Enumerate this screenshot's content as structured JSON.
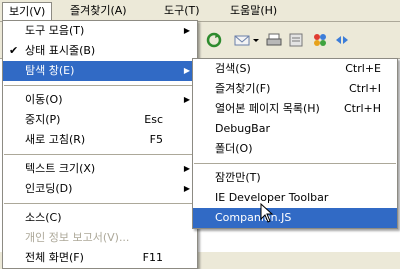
{
  "menubar": {
    "items": [
      {
        "label": "보기(V)"
      },
      {
        "label": "즐겨찾기(A)"
      },
      {
        "label": "도구(T)"
      },
      {
        "label": "도움말(H)"
      }
    ]
  },
  "toolbar": {
    "icons": [
      "refresh-icon",
      "mail-icon",
      "print-icon",
      "edit-icon",
      "messenger-icon",
      "media-icon"
    ]
  },
  "view_menu": {
    "items": [
      {
        "label": "도구 모음(T)",
        "arrow": true
      },
      {
        "label": "상태 표시줄(B)",
        "check": "✔"
      },
      {
        "label": "탐색 창(E)",
        "arrow": true,
        "highlighted": true
      },
      {
        "label": "이동(O)",
        "arrow": true
      },
      {
        "label": "중지(P)",
        "shortcut": "Esc"
      },
      {
        "label": "새로 고침(R)",
        "shortcut": "F5"
      },
      {
        "label": "텍스트 크기(X)",
        "arrow": true
      },
      {
        "label": "인코딩(D)",
        "arrow": true
      },
      {
        "label": "소스(C)"
      },
      {
        "label": "개인 정보 보고서(V)...",
        "disabled": true
      },
      {
        "label": "전체 화면(F)",
        "shortcut": "F11"
      }
    ]
  },
  "explorer_submenu": {
    "items": [
      {
        "label": "검색(S)",
        "shortcut": "Ctrl+E"
      },
      {
        "label": "즐겨찾기(F)",
        "shortcut": "Ctrl+I"
      },
      {
        "label": "열어본 페이지 목록(H)",
        "shortcut": "Ctrl+H"
      },
      {
        "label": "DebugBar"
      },
      {
        "label": "폴더(O)"
      },
      {
        "label": "잠깐만(T)"
      },
      {
        "label": "IE Developer Toolbar"
      },
      {
        "label": "Companion.JS",
        "highlighted": true
      }
    ]
  }
}
